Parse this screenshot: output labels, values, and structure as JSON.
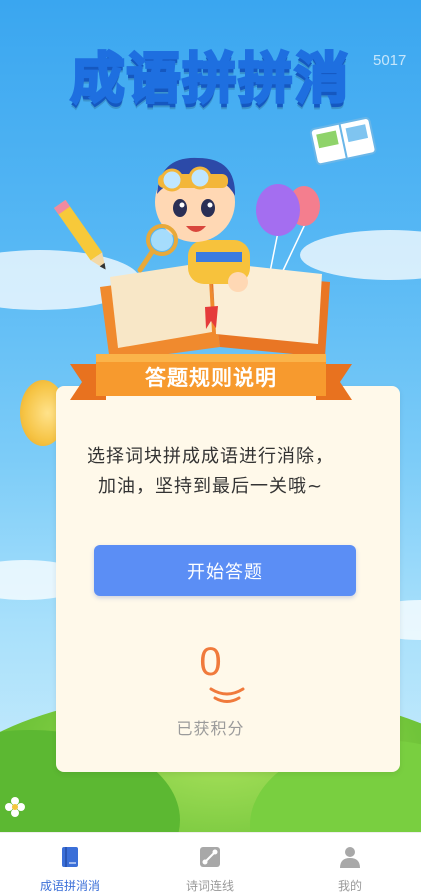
{
  "watermark": "5017",
  "title": "成语拼拼消",
  "rules": {
    "heading": "答题规则说明",
    "line1": "选择词块拼成成语进行消除，",
    "line2": "加油，坚持到最后一关哦~"
  },
  "start_button": "开始答题",
  "score": {
    "value": "0",
    "label": "已获积分"
  },
  "tabs": [
    {
      "label": "成语拼消消",
      "icon": "book-icon",
      "active": true
    },
    {
      "label": "诗词连线",
      "icon": "link-icon",
      "active": false
    },
    {
      "label": "我的",
      "icon": "person-icon",
      "active": false
    }
  ],
  "colors": {
    "accent": "#5b8ef5",
    "score": "#f07a3c",
    "tab_active": "#3b6fd8",
    "tab_inactive": "#999999",
    "card": "#fff9ea"
  }
}
